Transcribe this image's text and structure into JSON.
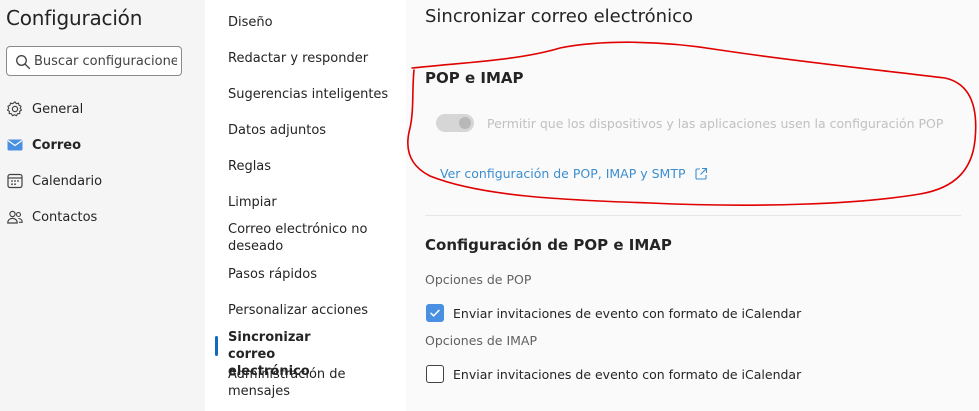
{
  "app": {
    "title": "Configuración"
  },
  "search": {
    "placeholder": "Buscar configuraciones"
  },
  "nav": [
    {
      "label": "General",
      "icon": "gear-icon"
    },
    {
      "label": "Correo",
      "icon": "mail-icon",
      "active": true
    },
    {
      "label": "Calendario",
      "icon": "calendar-icon"
    },
    {
      "label": "Contactos",
      "icon": "people-icon"
    }
  ],
  "submenu": [
    {
      "label": "Diseño"
    },
    {
      "label": "Redactar y responder"
    },
    {
      "label": "Sugerencias inteligentes"
    },
    {
      "label": "Datos adjuntos"
    },
    {
      "label": "Reglas"
    },
    {
      "label": "Limpiar"
    },
    {
      "label": "Correo electrónico no deseado"
    },
    {
      "label": "Pasos rápidos"
    },
    {
      "label": "Personalizar acciones"
    },
    {
      "label": "Sincronizar correo electrónico",
      "active": true
    },
    {
      "label": "Administración de mensajes"
    }
  ],
  "main": {
    "title": "Sincronizar correo electrónico",
    "pop_imap": {
      "heading": "POP e IMAP",
      "toggle_label": "Permitir que los dispositivos y las aplicaciones usen la configuración POP",
      "toggle_on": true,
      "toggle_disabled": true,
      "link": "Ver configuración de POP, IMAP y SMTP"
    },
    "config": {
      "heading": "Configuración de POP e IMAP",
      "pop_options_label": "Opciones de POP",
      "pop_checkbox_label": "Enviar invitaciones de evento con formato de iCalendar",
      "pop_checked": true,
      "imap_options_label": "Opciones de IMAP",
      "imap_checkbox_label": "Enviar invitaciones de evento con formato de iCalendar",
      "imap_checked": false
    }
  },
  "colors": {
    "accent": "#0f6cbd",
    "checkbox": "#4a90e2",
    "link": "#3c8ed0",
    "annotation": "#e00000"
  }
}
